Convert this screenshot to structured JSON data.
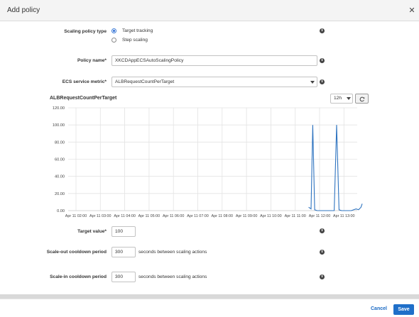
{
  "dialog": {
    "title": "Add policy"
  },
  "form": {
    "scaling_type": {
      "label": "Scaling policy type",
      "options": [
        {
          "label": "Target tracking",
          "selected": true
        },
        {
          "label": "Step scaling",
          "selected": false
        }
      ]
    },
    "policy_name": {
      "label": "Policy name*",
      "value": "XKCDAppECSAutoScalingPolicy"
    },
    "metric": {
      "label": "ECS service metric*",
      "value": "ALBRequestCountPerTarget"
    },
    "target_value": {
      "label": "Target value*",
      "value": "100"
    },
    "scale_out": {
      "label": "Scale-out cooldown period",
      "value": "300",
      "unit": "seconds between scaling actions"
    },
    "scale_in": {
      "label": "Scale-in cooldown period",
      "value": "300",
      "unit": "seconds between scaling actions"
    }
  },
  "chart_controls": {
    "range": "12h"
  },
  "chart_data": {
    "type": "line",
    "title": "ALBRequestCountPerTarget",
    "ylim": [
      0,
      120
    ],
    "ytick_labels": [
      "0.00",
      "20.00",
      "40.00",
      "60.00",
      "80.00",
      "100.00",
      "120.00"
    ],
    "xtick_labels": [
      "Apr 11 02:00",
      "Apr 11 03:00",
      "Apr 11 04:00",
      "Apr 11 05:00",
      "Apr 11 06:00",
      "Apr 11 07:00",
      "Apr 11 08:00",
      "Apr 11 09:00",
      "Apr 11 10:00",
      "Apr 11 11:00",
      "Apr 11 12:00",
      "Apr 11 13:00"
    ],
    "grid": true,
    "series": [
      {
        "color": "#2f74c0",
        "x_hours": [
          11.55,
          11.65,
          11.72,
          11.8,
          11.9,
          12.6,
          12.7,
          12.8,
          12.9,
          13.3,
          13.5,
          13.6,
          13.7,
          13.75
        ],
        "y": [
          4,
          2,
          100,
          1,
          0,
          0,
          100,
          1,
          0,
          0,
          2,
          1,
          4,
          8
        ]
      }
    ]
  },
  "footer": {
    "cancel_label": "Cancel",
    "save_label": "Save"
  }
}
